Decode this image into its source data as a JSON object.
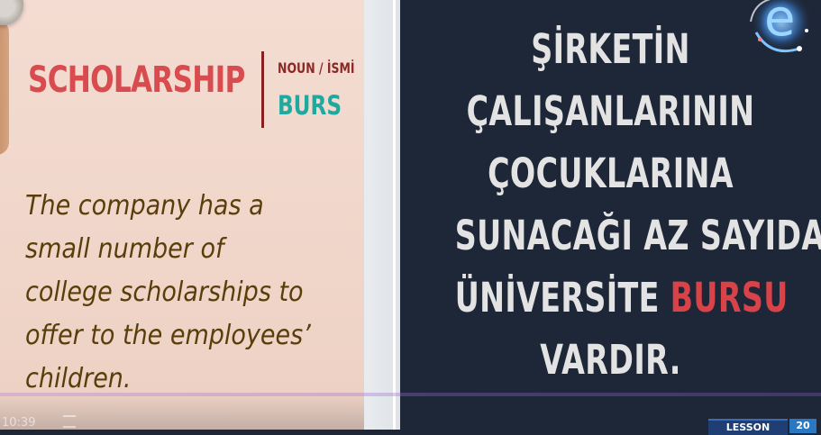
{
  "vocab": {
    "word": "SCHOLARSHIP",
    "part_of_speech": "NOUN / İSMİ",
    "translation": "BURS"
  },
  "example_lines": [
    "The company has a",
    "small number of",
    "college scholarships to",
    "offer to the employees’",
    "children."
  ],
  "turkish_lines": [
    "ŞİRKETİN",
    "ÇALIŞANLARININ",
    "ÇOCUKLARINA",
    "SUNACAĞI AZ SAYIDA"
  ],
  "turkish_line5_prefix": "ÜNİVERSİTE ",
  "turkish_highlight": "BURSU",
  "turkish_last": "VARDIR.",
  "highlight_color": "#d8434a",
  "player": {
    "time": "10:39"
  },
  "badge": {
    "label": "LESSON",
    "number": "20"
  },
  "logo_icon": "e-logo-icon"
}
